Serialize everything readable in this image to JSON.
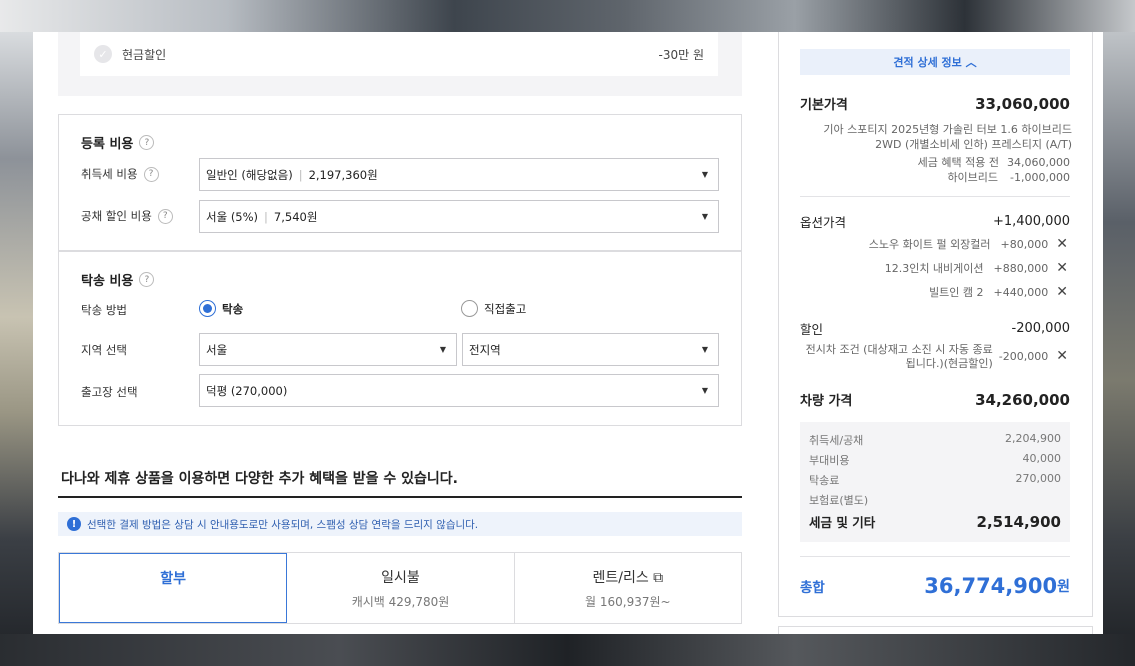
{
  "discount_row": {
    "label": "현금할인",
    "value": "-30만 원"
  },
  "registration": {
    "title": "등록 비용",
    "acquisition_tax": {
      "label": "취득세 비용",
      "value": "일반인 (해당없음)",
      "amount": "2,197,360원"
    },
    "bond_discount": {
      "label": "공채 할인 비용",
      "value": "서울 (5%)",
      "amount": "7,540원"
    }
  },
  "delivery": {
    "title": "탁송 비용",
    "method": {
      "label": "탁송 방법",
      "options": [
        "탁송",
        "직접출고"
      ],
      "selected": "탁송"
    },
    "region": {
      "label": "지역 선택",
      "value1": "서울",
      "value2": "전지역"
    },
    "factory": {
      "label": "출고장 선택",
      "value": "덕평 (270,000)"
    }
  },
  "promo": {
    "title": "다나와 제휴 상품을 이용하면 다양한 추가 혜택을 받을 수 있습니다.",
    "notice": "선택한 결제 방법은 상담 시 안내용도로만 사용되며, 스팸성 상담 연락을 드리지 않습니다.",
    "tabs": [
      {
        "title": "할부",
        "sub": ""
      },
      {
        "title": "일시불",
        "sub": "캐시백 429,780원"
      },
      {
        "title": "렌트/리스 ⧉",
        "sub": "월 160,937원~"
      }
    ]
  },
  "summary": {
    "detail_button": "견적 상세 정보 ︿",
    "base_price": {
      "label": "기본가격",
      "value": "33,060,000"
    },
    "model_desc": "기아 스포티지 2025년형 가솔린 터보 1.6 하이브리드 2WD (개별소비세 인하) 프레스티지 (A/T)",
    "tax_before": {
      "label": "세금 혜택 적용 전",
      "value": "34,060,000"
    },
    "hybrid": {
      "label": "하이브리드",
      "value": "-1,000,000"
    },
    "options": {
      "label": "옵션가격",
      "value": "+1,400,000",
      "items": [
        {
          "name": "스노우 화이트 펄 외장컬러",
          "price": "+80,000"
        },
        {
          "name": "12.3인치 내비게이션",
          "price": "+880,000"
        },
        {
          "name": "빌트인 캠 2",
          "price": "+440,000"
        }
      ]
    },
    "discount": {
      "label": "할인",
      "value": "-200,000",
      "item_line1": "전시차 조건 (대상재고 소진 시 자동 종료",
      "item_line2": "됩니다.)(현금할인)",
      "item_price": "-200,000"
    },
    "vehicle_price": {
      "label": "차량 가격",
      "value": "34,260,000"
    },
    "fees": [
      {
        "label": "취득세/공채",
        "value": "2,204,900"
      },
      {
        "label": "부대비용",
        "value": "40,000"
      },
      {
        "label": "탁송료",
        "value": "270,000"
      },
      {
        "label": "보험료(별도)",
        "value": ""
      }
    ],
    "tax_etc": {
      "label": "세금 및 기타",
      "value": "2,514,900"
    },
    "total": {
      "label": "총합",
      "value": "36,774,900",
      "unit": "원"
    }
  },
  "colors": {
    "accent": "#2f6fd6"
  }
}
